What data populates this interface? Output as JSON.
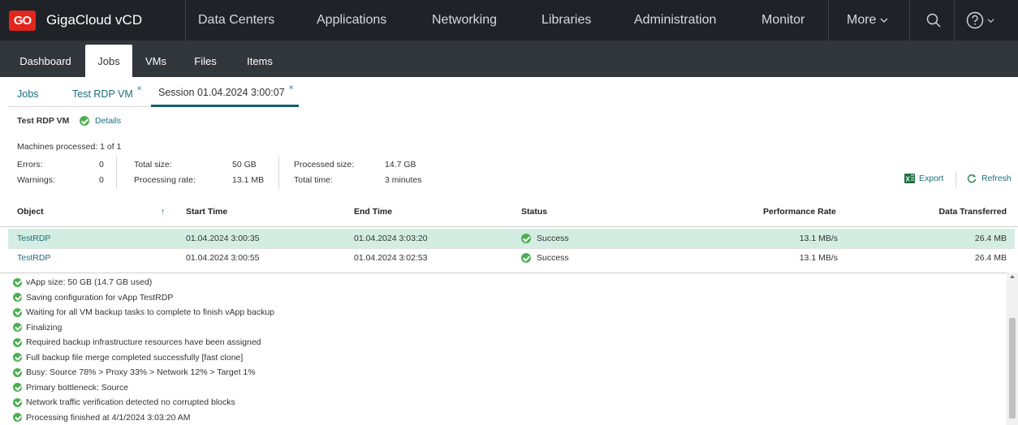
{
  "app": {
    "logo_text": "GO",
    "brand": "GigaCloud vCD"
  },
  "topnav": {
    "data_centers": "Data Centers",
    "applications": "Applications",
    "networking": "Networking",
    "libraries": "Libraries",
    "administration": "Administration",
    "monitor": "Monitor",
    "more": "More"
  },
  "subnav": [
    "Dashboard",
    "Jobs",
    "VMs",
    "Files",
    "Items"
  ],
  "breadcrumbs": {
    "jobs": "Jobs",
    "test_rdp_vm": "Test RDP VM",
    "session": "Session 01.04.2024 3:00:07",
    "close_glyph": "×"
  },
  "summary": {
    "title": "Test RDP VM",
    "details_link": "Details",
    "machines_processed": "Machines processed: 1 of 1",
    "errors_label": "Errors:",
    "errors_value": "0",
    "warnings_label": "Warnings:",
    "warnings_value": "0",
    "total_size_label": "Total size:",
    "total_size_value": "50 GB",
    "processing_rate_label": "Processing rate:",
    "processing_rate_value": "13.1 MB",
    "processed_size_label": "Processed size:",
    "processed_size_value": "14.7 GB",
    "total_time_label": "Total time:",
    "total_time_value": "3 minutes"
  },
  "actions": {
    "export": "Export",
    "refresh": "Refresh"
  },
  "table": {
    "headers": {
      "object": "Object",
      "sort_indicator": "↑",
      "start_time": "Start Time",
      "end_time": "End Time",
      "status": "Status",
      "performance_rate": "Performance Rate",
      "data_transferred": "Data Transferred"
    },
    "rows": [
      {
        "object": "TestRDP",
        "start": "01.04.2024 3:00:35",
        "end": "01.04.2024 3:03:20",
        "status": "Success",
        "rate": "13.1 MB/s",
        "data": "26.4 MB"
      },
      {
        "object": "TestRDP",
        "start": "01.04.2024 3:00:55",
        "end": "01.04.2024 3:02:53",
        "status": "Success",
        "rate": "13.1 MB/s",
        "data": "26.4 MB"
      }
    ]
  },
  "log": [
    "vApp size: 50 GB (14.7 GB used)",
    "Saving configuration for vApp TestRDP",
    "Waiting for all VM backup tasks to complete to finish vApp backup",
    "Finalizing",
    "Required backup infrastructure resources have been assigned",
    "Full backup file merge completed successfully [fast clone]",
    "Busy: Source 78% > Proxy 33% > Network 12% > Target 1%",
    "Primary bottleneck: Source",
    "Network traffic verification detected no corrupted blocks",
    "Processing finished at 4/1/2024 3:03:20 AM"
  ],
  "colors": {
    "accent": "#1a6f7a",
    "logo": "#e3251d",
    "success": "#4caf50",
    "selected_row": "#d4ede3",
    "topbar": "#1f2328",
    "subnav": "#31363b"
  },
  "icons": [
    "search-icon",
    "help-icon",
    "chevron-down-icon",
    "check-circle-icon",
    "excel-icon",
    "refresh-icon",
    "sort-up-icon",
    "close-icon"
  ]
}
